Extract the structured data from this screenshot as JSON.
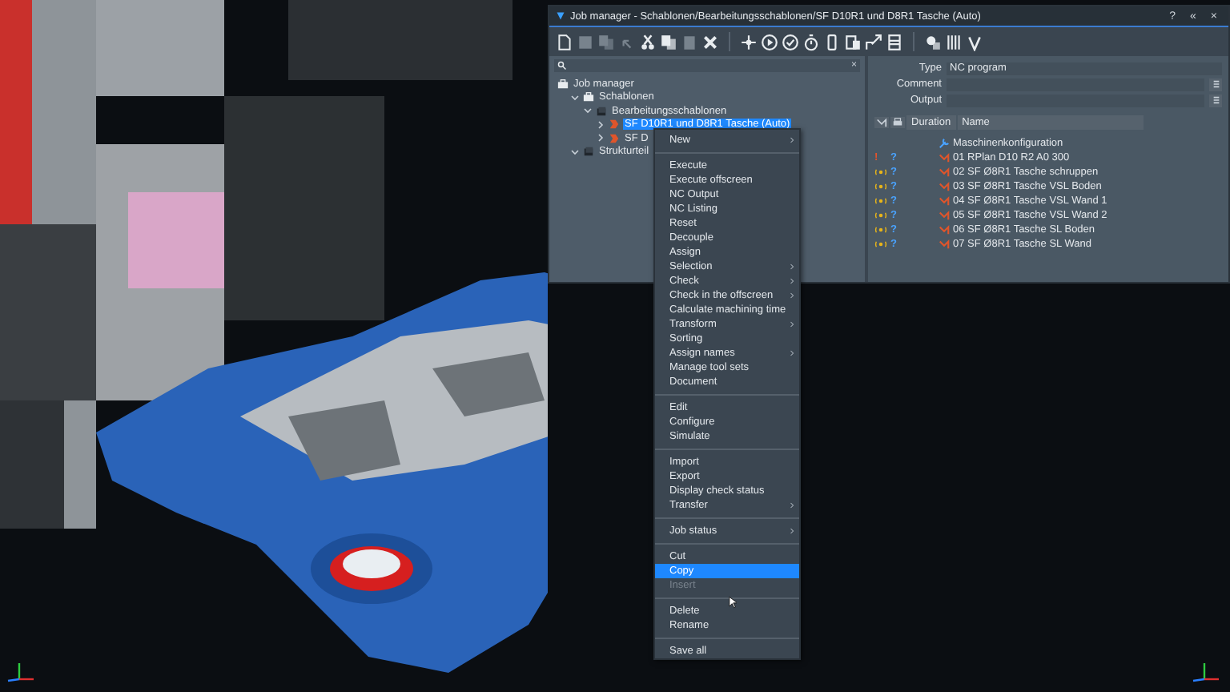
{
  "window": {
    "title": "Job manager - Schablonen/Bearbeitungsschablonen/SF D10R1 und D8R1 Tasche (Auto)",
    "buttons": [
      "?",
      "«",
      "×"
    ]
  },
  "toolbar": [
    {
      "kind": "new",
      "disabled": false
    },
    {
      "kind": "save",
      "disabled": true
    },
    {
      "kind": "copy",
      "disabled": true
    },
    {
      "kind": "undo",
      "disabled": true
    },
    {
      "kind": "cut",
      "disabled": false
    },
    {
      "kind": "copy",
      "disabled": false
    },
    {
      "kind": "paste",
      "disabled": true
    },
    {
      "kind": "delete",
      "disabled": false
    },
    {
      "kind": "separator",
      "disabled": false
    },
    {
      "kind": "move",
      "disabled": false
    },
    {
      "kind": "play",
      "disabled": false
    },
    {
      "kind": "check",
      "disabled": false
    },
    {
      "kind": "timer",
      "disabled": false
    },
    {
      "kind": "page",
      "disabled": false
    },
    {
      "kind": "clipboard",
      "disabled": false
    },
    {
      "kind": "export",
      "disabled": false
    },
    {
      "kind": "list",
      "disabled": false
    },
    {
      "kind": "separator",
      "disabled": false
    },
    {
      "kind": "tools",
      "disabled": false
    },
    {
      "kind": "columns",
      "disabled": false
    },
    {
      "kind": "tick",
      "disabled": false
    }
  ],
  "search": {
    "clear": "×"
  },
  "tree": [
    {
      "label": "Job manager",
      "kind": "root",
      "selected": false,
      "children": [
        {
          "label": "Schablonen",
          "kind": "folder",
          "expanded": true,
          "selected": false,
          "children": [
            {
              "label": "Bearbeitungsschablonen",
              "kind": "group",
              "expanded": true,
              "selected": false,
              "children": [
                {
                  "label": "SF D10R1 und D8R1 Tasche (Auto)",
                  "kind": "program",
                  "expanded": false,
                  "selected": true
                },
                {
                  "label": "SF D",
                  "kind": "program",
                  "expanded": false,
                  "selected": false
                }
              ]
            }
          ]
        },
        {
          "label": "Strukturteil",
          "kind": "group",
          "expanded": true,
          "selected": false
        }
      ]
    }
  ],
  "properties": [
    {
      "label": "Type",
      "value": "NC program",
      "button": false
    },
    {
      "label": "Comment",
      "button": true
    },
    {
      "label": "Output",
      "button": true
    }
  ],
  "table": {
    "columns": [
      "Duration",
      "Name"
    ],
    "rows": [
      {
        "kind": "config",
        "name": "Maschinenkonfiguration"
      },
      {
        "kind": "operation",
        "status": {
          "kind": "error",
          "text": "!"
        },
        "check": "?",
        "name": "01 RPlan D10 R2  A0 300"
      },
      {
        "kind": "operation",
        "status": {
          "kind": "running"
        },
        "check": "?",
        "name": "02 SF Ø8R1 Tasche schruppen"
      },
      {
        "kind": "operation",
        "status": {
          "kind": "running"
        },
        "check": "?",
        "name": "03 SF Ø8R1 Tasche VSL Boden"
      },
      {
        "kind": "operation",
        "status": {
          "kind": "running"
        },
        "check": "?",
        "name": "04 SF Ø8R1 Tasche VSL Wand 1"
      },
      {
        "kind": "operation",
        "status": {
          "kind": "running"
        },
        "check": "?",
        "name": "05 SF Ø8R1 Tasche VSL Wand 2"
      },
      {
        "kind": "operation",
        "status": {
          "kind": "running"
        },
        "check": "?",
        "name": "06 SF Ø8R1 Tasche SL Boden"
      },
      {
        "kind": "operation",
        "status": {
          "kind": "running"
        },
        "check": "?",
        "name": "07 SF Ø8R1 Tasche SL Wand"
      }
    ]
  },
  "context_menu": {
    "groups": [
      [
        {
          "label": "New",
          "submenu": true,
          "selected": false,
          "disabled": false
        }
      ],
      [
        {
          "label": "Execute",
          "submenu": false,
          "selected": false,
          "disabled": false
        },
        {
          "label": "Execute offscreen",
          "submenu": false,
          "selected": false,
          "disabled": false
        },
        {
          "label": "NC Output",
          "submenu": false,
          "selected": false,
          "disabled": false
        },
        {
          "label": "NC Listing",
          "submenu": false,
          "selected": false,
          "disabled": false
        },
        {
          "label": "Reset",
          "submenu": false,
          "selected": false,
          "disabled": false
        },
        {
          "label": "Decouple",
          "submenu": false,
          "selected": false,
          "disabled": false
        },
        {
          "label": "Assign",
          "submenu": false,
          "selected": false,
          "disabled": false
        },
        {
          "label": "Selection",
          "submenu": true,
          "selected": false,
          "disabled": false
        },
        {
          "label": "Check",
          "submenu": true,
          "selected": false,
          "disabled": false
        },
        {
          "label": "Check in the offscreen",
          "submenu": true,
          "selected": false,
          "disabled": false
        },
        {
          "label": "Calculate machining time",
          "submenu": false,
          "selected": false,
          "disabled": false
        },
        {
          "label": "Transform",
          "submenu": true,
          "selected": false,
          "disabled": false
        },
        {
          "label": "Sorting",
          "submenu": false,
          "selected": false,
          "disabled": false
        },
        {
          "label": "Assign names",
          "submenu": true,
          "selected": false,
          "disabled": false
        },
        {
          "label": "Manage tool sets",
          "submenu": false,
          "selected": false,
          "disabled": false
        },
        {
          "label": "Document",
          "submenu": false,
          "selected": false,
          "disabled": false
        }
      ],
      [
        {
          "label": "Edit",
          "submenu": false,
          "selected": false,
          "disabled": false
        },
        {
          "label": "Configure",
          "submenu": false,
          "selected": false,
          "disabled": false
        },
        {
          "label": "Simulate",
          "submenu": false,
          "selected": false,
          "disabled": false
        }
      ],
      [
        {
          "label": "Import",
          "submenu": false,
          "selected": false,
          "disabled": false
        },
        {
          "label": "Export",
          "submenu": false,
          "selected": false,
          "disabled": false
        },
        {
          "label": "Display check status",
          "submenu": false,
          "selected": false,
          "disabled": false
        },
        {
          "label": "Transfer",
          "submenu": true,
          "selected": false,
          "disabled": false
        }
      ],
      [
        {
          "label": "Job status",
          "submenu": true,
          "selected": false,
          "disabled": false
        }
      ],
      [
        {
          "label": "Cut",
          "submenu": false,
          "selected": false,
          "disabled": false
        },
        {
          "label": "Copy",
          "submenu": false,
          "selected": true,
          "disabled": false
        },
        {
          "label": "Insert",
          "submenu": false,
          "selected": false,
          "disabled": true
        }
      ],
      [
        {
          "label": "Delete",
          "submenu": false,
          "selected": false,
          "disabled": false
        },
        {
          "label": "Rename",
          "submenu": false,
          "selected": false,
          "disabled": false
        }
      ],
      [
        {
          "label": "Save all",
          "submenu": false,
          "selected": false,
          "disabled": false
        }
      ]
    ]
  }
}
